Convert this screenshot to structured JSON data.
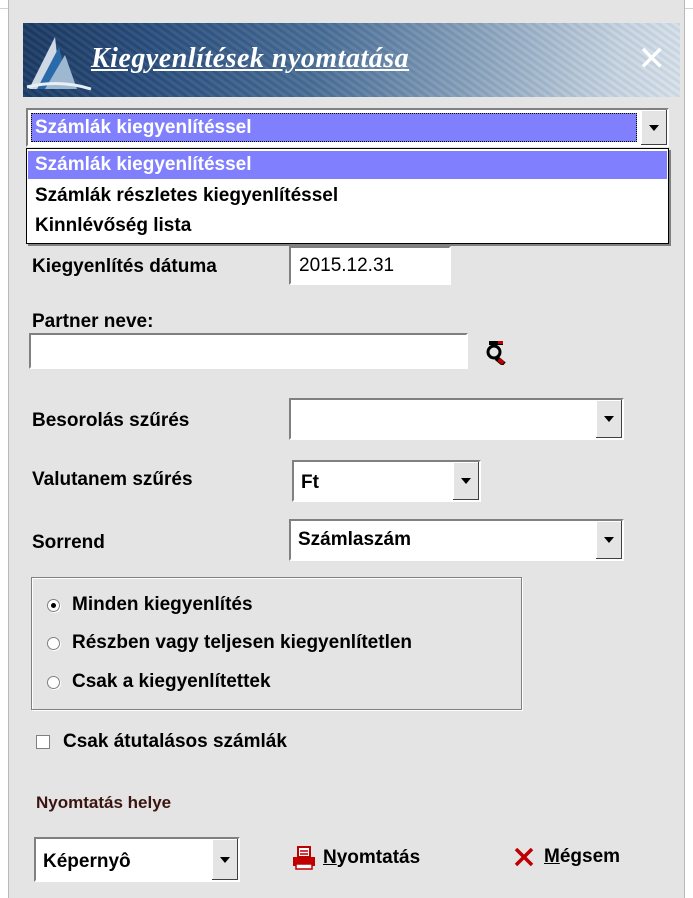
{
  "window": {
    "title": "Kiegyenlítések nyomtatása",
    "close_symbol": "✕"
  },
  "report_type": {
    "selected": "Számlák kiegyenlítéssel",
    "options": [
      "Számlák kiegyenlítéssel",
      "Számlák részletes kiegyenlítéssel",
      "Kinnlévőség lista"
    ]
  },
  "settlement_date": {
    "label": "Kiegyenlítés dátuma",
    "value": "2015.12.31"
  },
  "partner": {
    "label": "Partner neve:",
    "value": "",
    "search_icon": "binoculars-search-icon"
  },
  "classification": {
    "label": "Besorolás szűrés",
    "value": ""
  },
  "currency": {
    "label": "Valutanem szűrés",
    "value": "Ft"
  },
  "order": {
    "label": "Sorrend",
    "value": "Számlaszám"
  },
  "settlement_filter": {
    "options": [
      {
        "label": "Minden kiegyenlítés",
        "checked": true
      },
      {
        "label": "Részben vagy teljesen kiegyenlítetlen",
        "checked": false
      },
      {
        "label": "Csak a kiegyenlítettek",
        "checked": false
      }
    ]
  },
  "transfer_only": {
    "label": "Csak átutalásos számlák",
    "checked": false
  },
  "print_location": {
    "label": "Nyomtatás helye",
    "value": "Képernyô"
  },
  "buttons": {
    "print_hotkey": "N",
    "print_rest": "yomtatás",
    "cancel_hotkey": "M",
    "cancel_rest": "égsem"
  },
  "colors": {
    "selection": "#8080ff",
    "window_bg": "#e4e4e4",
    "print_icon": "#c00000",
    "cancel_icon": "#c00000"
  }
}
